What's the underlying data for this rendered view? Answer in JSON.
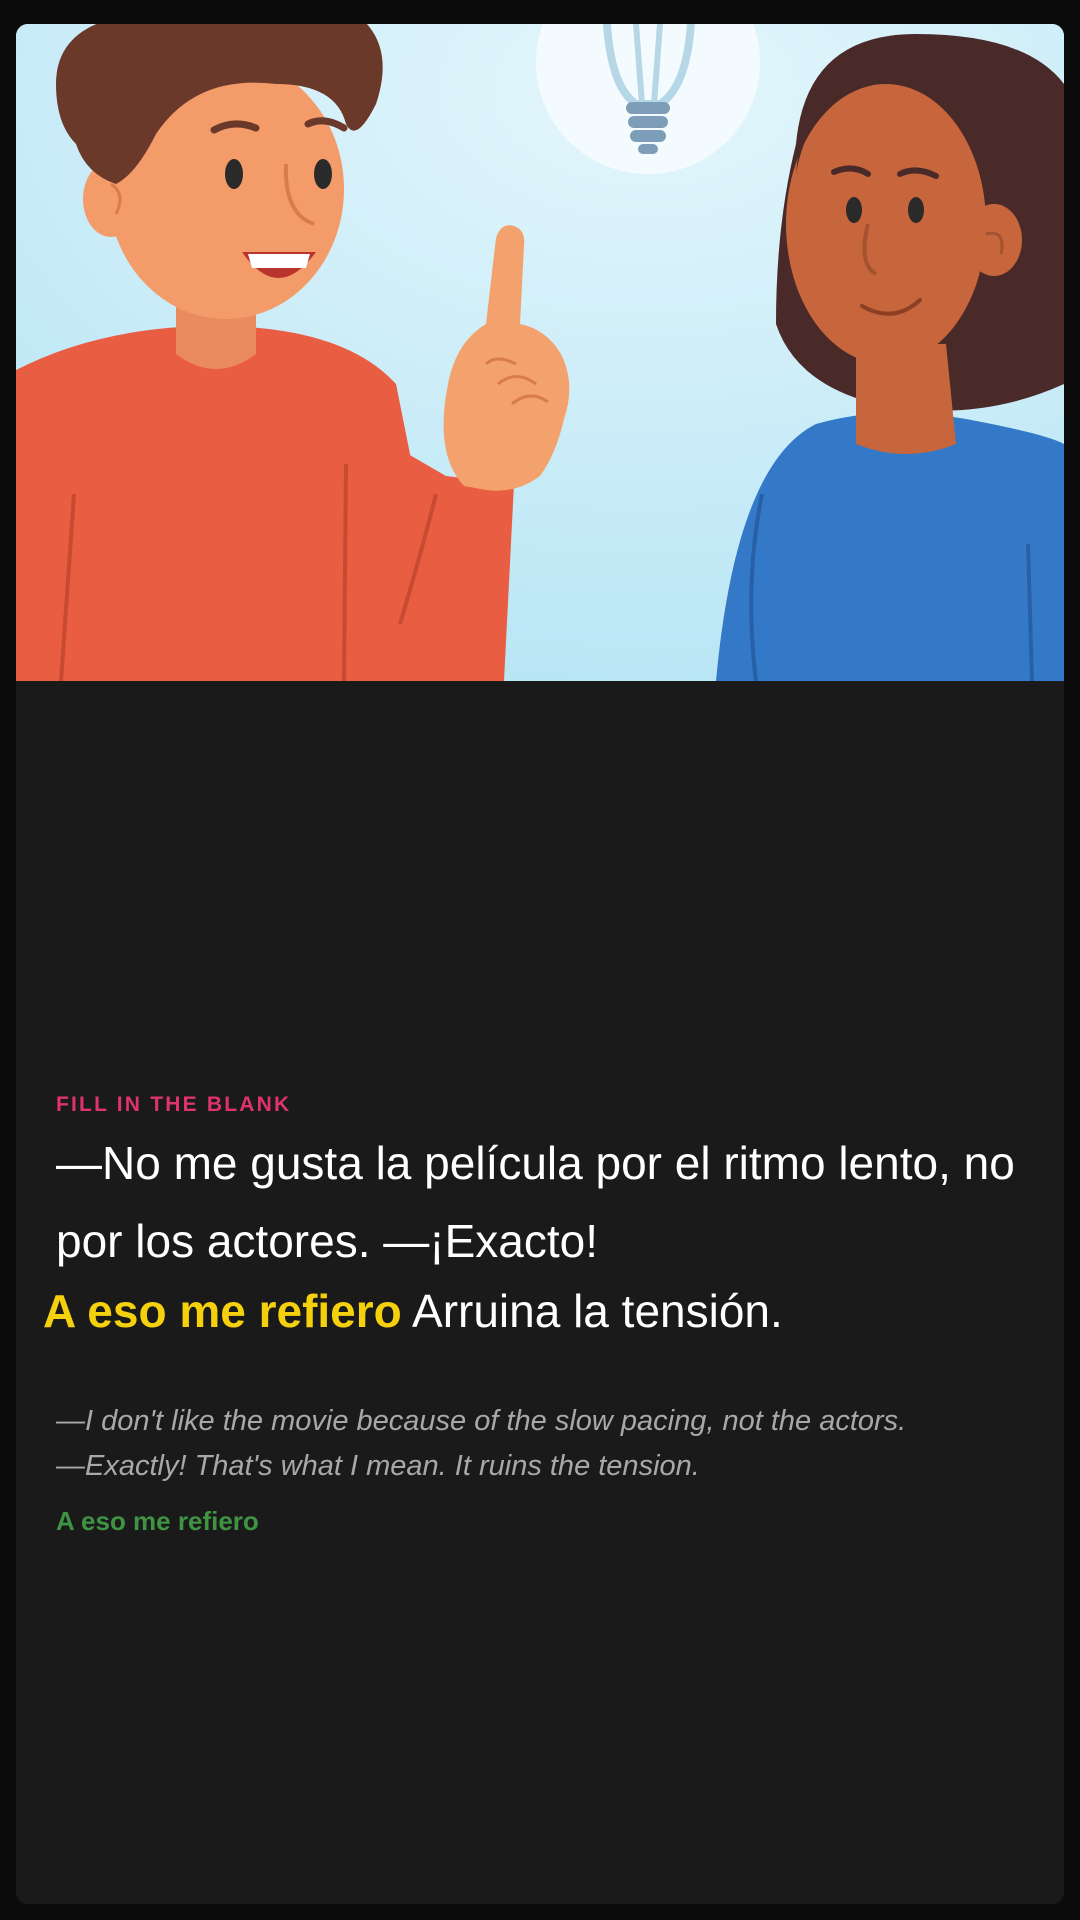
{
  "illustration": {
    "icons": [
      "man-pointing-icon",
      "woman-listening-icon",
      "lightbulb-icon"
    ]
  },
  "exercise": {
    "label": "FILL IN THE BLANK",
    "prompt_line1": "—No me gusta la película por el ritmo lento, no por los actores. —¡Exacto!",
    "blank_text": "A eso me refiero",
    "prompt_line2_rest": " Arruina la tensión.",
    "translation_line1": "—I don't like the movie because of the slow pacing, not the actors.",
    "translation_line2": "—Exactly! That's what I mean. It ruins the tension.",
    "answer": "A eso me refiero"
  },
  "colors": {
    "label": "#e0336e",
    "blank": "#f5d00c",
    "answer": "#3f9443",
    "background": "#1a1a1a",
    "sky": "#c5ebf7"
  }
}
